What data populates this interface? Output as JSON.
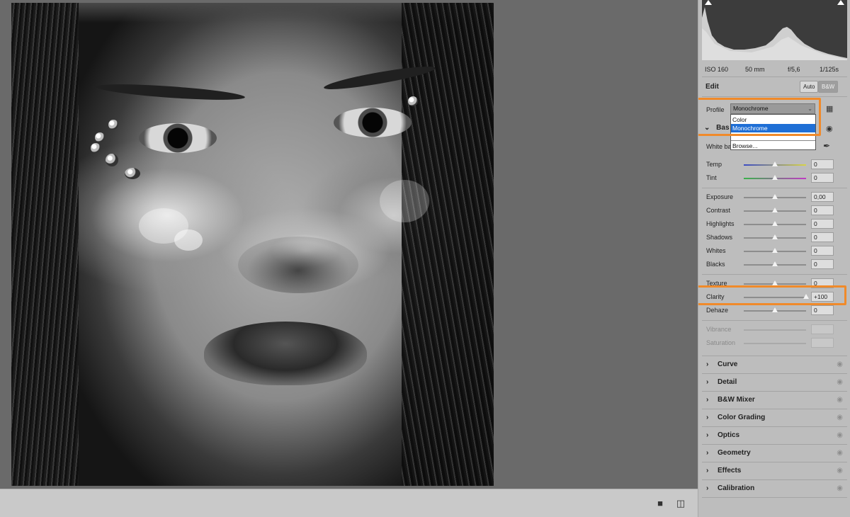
{
  "photo": {
    "description_icon": "portrait-photo"
  },
  "bottom_bar": {
    "icons": [
      "view-mode-icon",
      "before-after-icon"
    ]
  },
  "histogram": {
    "shadow_clip_icon": "triangle-icon",
    "highlight_clip_icon": "triangle-icon"
  },
  "metadata": {
    "iso": "ISO 160",
    "focal": "50 mm",
    "aperture": "f/5,6",
    "shutter": "1/125s"
  },
  "edit": {
    "title": "Edit",
    "auto_label": "Auto",
    "bw_label": "B&W"
  },
  "profile": {
    "label": "Profile",
    "selected": "Monochrome",
    "options": [
      "Color",
      "Monochrome",
      "Browse..."
    ]
  },
  "basic": {
    "title_partial": "Bas",
    "white_balance_label_partial": "White ba"
  },
  "sliders": {
    "temp": {
      "label": "Temp",
      "value": "0"
    },
    "tint": {
      "label": "Tint",
      "value": "0"
    },
    "exposure": {
      "label": "Exposure",
      "value": "0,00"
    },
    "contrast": {
      "label": "Contrast",
      "value": "0"
    },
    "highlights": {
      "label": "Highlights",
      "value": "0"
    },
    "shadows": {
      "label": "Shadows",
      "value": "0"
    },
    "whites": {
      "label": "Whites",
      "value": "0"
    },
    "blacks": {
      "label": "Blacks",
      "value": "0"
    },
    "texture": {
      "label": "Texture",
      "value": "0"
    },
    "clarity": {
      "label": "Clarity",
      "value": "+100"
    },
    "dehaze": {
      "label": "Dehaze",
      "value": "0"
    },
    "vibrance": {
      "label": "Vibrance",
      "value": ""
    },
    "saturation": {
      "label": "Saturation",
      "value": ""
    }
  },
  "sections": [
    "Curve",
    "Detail",
    "B&W Mixer",
    "Color Grading",
    "Optics",
    "Geometry",
    "Effects",
    "Calibration"
  ],
  "colors": {
    "highlight": "#f08a2a",
    "selection": "#1f6fd6"
  }
}
